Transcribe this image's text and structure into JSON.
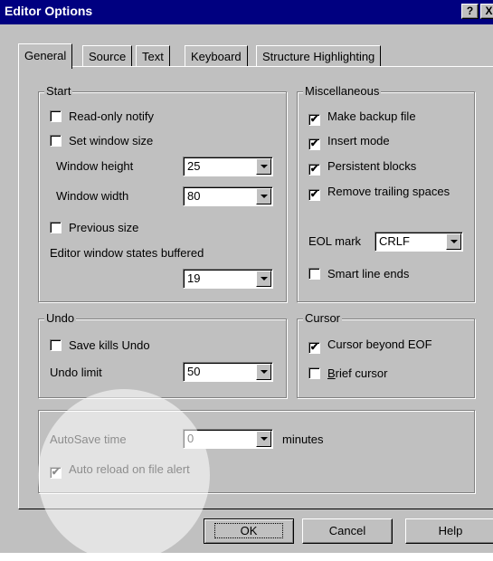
{
  "window": {
    "title": "Editor Options",
    "help_glyph": "?",
    "close_glyph": "X"
  },
  "tabs": [
    "General",
    "Source",
    "Text",
    "Keyboard",
    "Structure Highlighting"
  ],
  "start": {
    "legend": "Start",
    "read_only_notify": {
      "label": "Read-only notify",
      "checked": false
    },
    "set_window_size": {
      "label": "Set window size",
      "checked": false
    },
    "window_height": {
      "label": "Window height",
      "value": "25"
    },
    "window_width": {
      "label": "Window width",
      "value": "80"
    },
    "previous_size": {
      "label": "Previous size",
      "checked": false
    },
    "states_buffered": {
      "label": "Editor window states buffered",
      "value": "19"
    }
  },
  "misc": {
    "legend": "Miscellaneous",
    "make_backup": {
      "label": "Make backup file",
      "checked": true
    },
    "insert_mode": {
      "label": "Insert mode",
      "checked": true
    },
    "persistent_blocks": {
      "label": "Persistent blocks",
      "checked": true
    },
    "remove_trailing": {
      "label": "Remove trailing spaces",
      "checked": true
    },
    "eol_mark": {
      "label": "EOL mark",
      "value": "CRLF"
    },
    "smart_line_ends": {
      "label": "Smart line ends",
      "checked": false
    }
  },
  "undo": {
    "legend": "Undo",
    "save_kills_undo": {
      "label": "Save kills Undo",
      "checked": false
    },
    "undo_limit": {
      "label": "Undo limit",
      "value": "50"
    }
  },
  "cursor": {
    "legend": "Cursor",
    "beyond_eof": {
      "label": "Cursor beyond EOF",
      "checked": true
    },
    "brief_cursor": {
      "label_underlined": "B",
      "label_rest": "rief cursor",
      "checked": false
    }
  },
  "autosave": {
    "label": "AutoSave time",
    "value": "0",
    "unit": "minutes",
    "auto_reload": {
      "label": "Auto reload on file alert",
      "checked": true
    }
  },
  "buttons": {
    "ok": "OK",
    "cancel": "Cancel",
    "help": "Help"
  },
  "check_glyph": "✔"
}
